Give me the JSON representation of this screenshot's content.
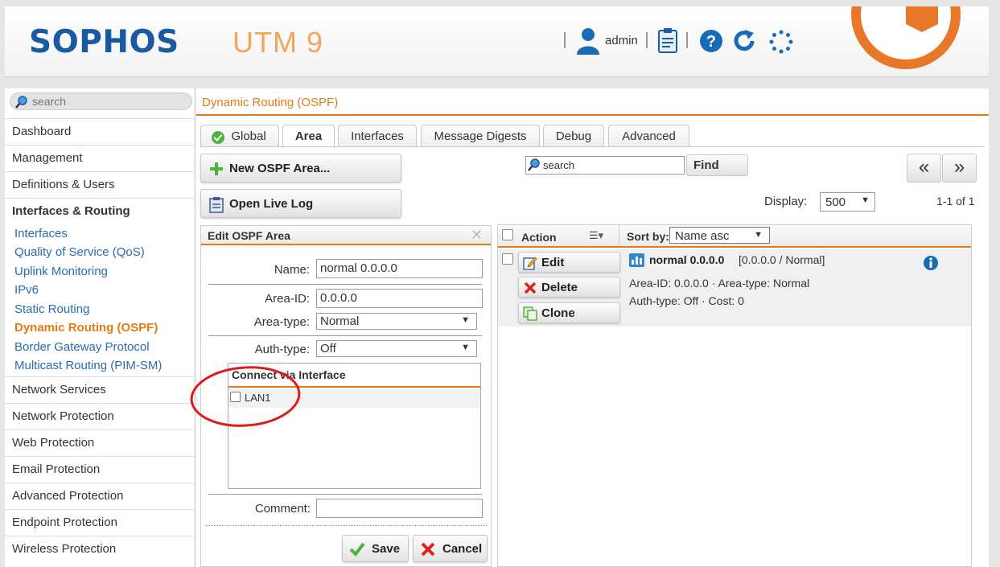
{
  "header": {
    "logo": "SOPHOS",
    "product": "UTM 9",
    "username": "admin",
    "colors": {
      "logo": "#1a5aa0",
      "product": "#f2a65a",
      "accent": "#e47b14"
    }
  },
  "nav": {
    "search_placeholder": "search",
    "items": [
      {
        "label": "Dashboard"
      },
      {
        "label": "Management"
      },
      {
        "label": "Definitions & Users"
      },
      {
        "label": "Interfaces & Routing"
      },
      {
        "label": "Network Services"
      },
      {
        "label": "Network Protection"
      },
      {
        "label": "Web Protection"
      },
      {
        "label": "Email Protection"
      },
      {
        "label": "Advanced Protection"
      },
      {
        "label": "Endpoint Protection"
      },
      {
        "label": "Wireless Protection"
      }
    ],
    "subitems": [
      {
        "label": "Interfaces"
      },
      {
        "label": "Quality of Service (QoS)"
      },
      {
        "label": "Uplink Monitoring"
      },
      {
        "label": "IPv6"
      },
      {
        "label": "Static Routing"
      },
      {
        "label": "Dynamic Routing (OSPF)"
      },
      {
        "label": "Border Gateway Protocol"
      },
      {
        "label": "Multicast Routing (PIM-SM)"
      }
    ]
  },
  "main": {
    "title": "Dynamic Routing (OSPF)",
    "tabs": [
      {
        "label": "Global"
      },
      {
        "label": "Area"
      },
      {
        "label": "Interfaces"
      },
      {
        "label": "Message Digests"
      },
      {
        "label": "Debug"
      },
      {
        "label": "Advanced"
      }
    ],
    "new_button": "New OSPF Area...",
    "log_button": "Open Live Log",
    "search_placeholder": "search",
    "find_button": "Find",
    "pager_prev": "«",
    "pager_next": "»",
    "display_label": "Display:",
    "display_value": "500",
    "count": "1-1 of 1"
  },
  "edit": {
    "title": "Edit OSPF Area",
    "close": "✕",
    "name_label": "Name:",
    "name_value": "normal 0.0.0.0",
    "area_id_label": "Area-ID:",
    "area_id_value": "0.0.0.0",
    "area_type_label": "Area-type:",
    "area_type_value": "Normal",
    "auth_type_label": "Auth-type:",
    "auth_type_value": "Off",
    "connect_title": "Connect via Interface",
    "interfaces": [
      {
        "label": "LAN1",
        "checked": false
      }
    ],
    "comment_label": "Comment:",
    "comment_value": "",
    "save_button": "Save",
    "cancel_button": "Cancel"
  },
  "list": {
    "action_header": "Action",
    "sort_label": "Sort by:",
    "sort_value": "Name asc",
    "rows": [
      {
        "edit": "Edit",
        "delete": "Delete",
        "clone": "Clone",
        "name": "normal 0.0.0.0",
        "desc": "[0.0.0.0 / Normal]",
        "line1": "Area-ID: 0.0.0.0 · Area-type: Normal",
        "line2": "Auth-type: Off · Cost: 0"
      }
    ]
  }
}
